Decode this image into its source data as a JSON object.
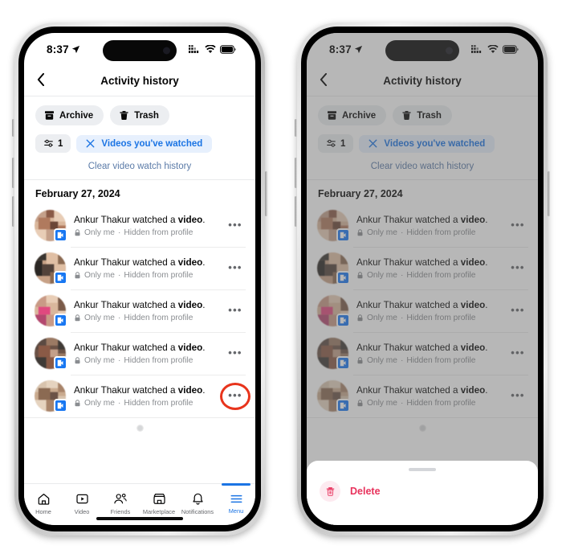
{
  "status_bar": {
    "time": "8:37",
    "location_icon": "location-arrow-icon",
    "cellular_icon": "cellular-signal-icon",
    "wifi_icon": "wifi-icon",
    "battery_icon": "battery-icon"
  },
  "nav": {
    "back_icon": "chevron-left-icon",
    "title": "Activity history"
  },
  "chips": [
    {
      "label": "Archive",
      "icon": "archive-box-icon"
    },
    {
      "label": "Trash",
      "icon": "trash-can-icon"
    }
  ],
  "filters": {
    "count_label": "1",
    "count_icon": "sliders-icon",
    "pill_label": "Videos you've watched",
    "pill_close_icon": "x-close-icon",
    "clear_link": "Clear video watch history"
  },
  "date_header": "February 27, 2024",
  "rows": [
    {
      "title_prefix": "Ankur Thakur watched a ",
      "title_bold": "video",
      "title_suffix": ".",
      "privacy": "Only me",
      "separator": "·",
      "visibility": "Hidden from profile",
      "lock_icon": "lock-icon",
      "badge_icon": "facebook-video-badge-icon",
      "menu_icon": "more-options-icon",
      "thumb_colors": [
        "#c4a08a",
        "#d9b79c",
        "#8a5a46",
        "#e8cdb6",
        "#b07a5e",
        "#6b4636"
      ]
    },
    {
      "title_prefix": "Ankur Thakur watched a ",
      "title_bold": "video",
      "title_suffix": ".",
      "privacy": "Only me",
      "separator": "·",
      "visibility": "Hidden from profile",
      "lock_icon": "lock-icon",
      "badge_icon": "facebook-video-badge-icon",
      "menu_icon": "more-options-icon",
      "thumb_colors": [
        "#3a3530",
        "#c7a186",
        "#2b2724",
        "#e0bfa4",
        "#8b6a52",
        "#52423a"
      ]
    },
    {
      "title_prefix": "Ankur Thakur watched a ",
      "title_bold": "video",
      "title_suffix": ".",
      "privacy": "Only me",
      "separator": "·",
      "visibility": "Hidden from profile",
      "lock_icon": "lock-icon",
      "badge_icon": "facebook-video-badge-icon",
      "menu_icon": "more-options-icon",
      "thumb_colors": [
        "#c99a86",
        "#e0497f",
        "#d9b79c",
        "#b3486f",
        "#7a5a48",
        "#e8cdb6"
      ]
    },
    {
      "title_prefix": "Ankur Thakur watched a ",
      "title_bold": "video",
      "title_suffix": ".",
      "privacy": "Only me",
      "separator": "·",
      "visibility": "Hidden from profile",
      "lock_icon": "lock-icon",
      "badge_icon": "facebook-video-badge-icon",
      "menu_icon": "more-options-icon",
      "thumb_colors": [
        "#5b4a42",
        "#8a5a46",
        "#3f3a36",
        "#9b7a64",
        "#6b5246",
        "#c4a08a"
      ]
    },
    {
      "title_prefix": "Ankur Thakur watched a ",
      "title_bold": "video",
      "title_suffix": ".",
      "privacy": "Only me",
      "separator": "·",
      "visibility": "Hidden from profile",
      "lock_icon": "lock-icon",
      "badge_icon": "facebook-video-badge-icon",
      "menu_icon": "more-options-icon",
      "thumb_colors": [
        "#d8c3ad",
        "#a8846a",
        "#e5d3bf",
        "#8b6a52",
        "#c9aa8e",
        "#6b5246"
      ]
    }
  ],
  "loading_spinner": "loading-spinner-icon",
  "tabbar": [
    {
      "label": "Home",
      "icon": "home-icon",
      "active": false
    },
    {
      "label": "Video",
      "icon": "video-icon",
      "active": false
    },
    {
      "label": "Friends",
      "icon": "friends-icon",
      "active": false
    },
    {
      "label": "Marketplace",
      "icon": "marketplace-icon",
      "active": false
    },
    {
      "label": "Notifications",
      "icon": "bell-icon",
      "active": false
    },
    {
      "label": "Menu",
      "icon": "hamburger-menu-icon",
      "active": true
    }
  ],
  "action_sheet": {
    "grabber": "sheet-grabber",
    "delete_label": "Delete",
    "delete_icon": "trash-can-icon"
  },
  "annotation": {
    "highlight_ring": "red-highlight-circle",
    "highlight_color": "#e8341c"
  }
}
